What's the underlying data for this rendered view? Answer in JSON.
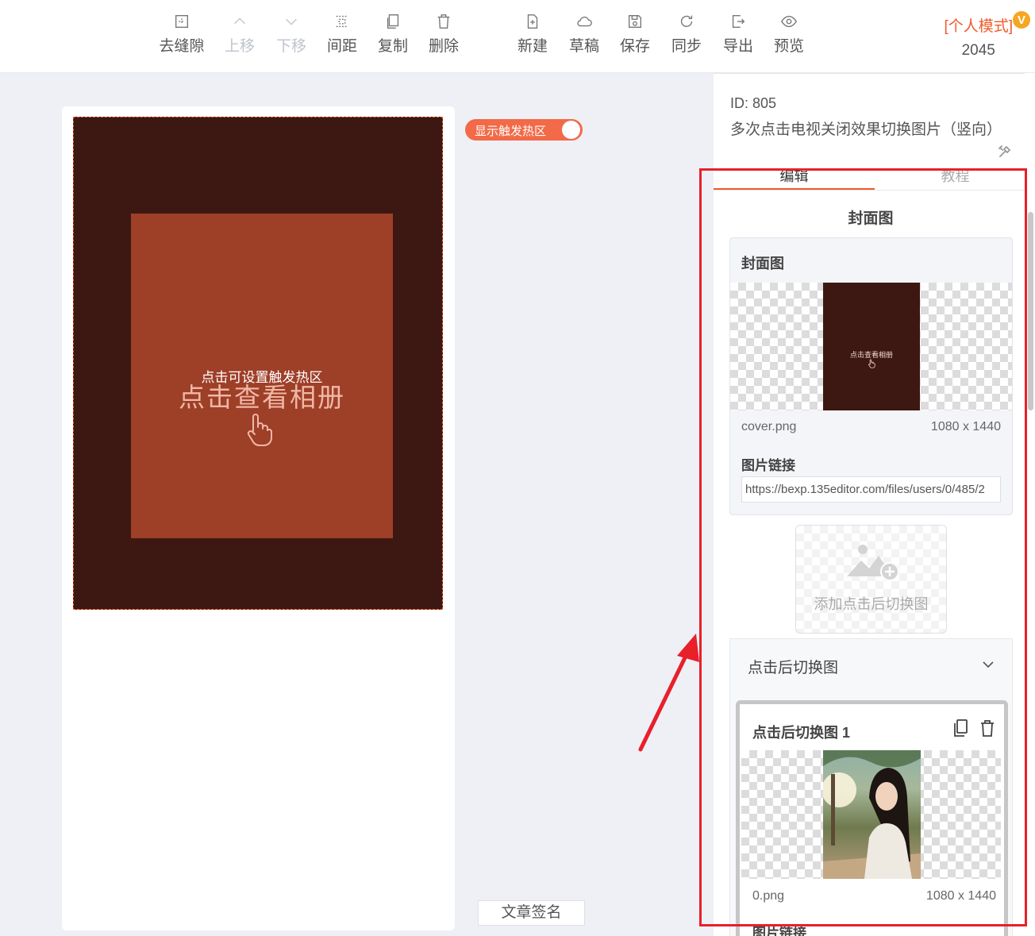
{
  "toolbar": {
    "items": [
      {
        "label": "去缝隙",
        "icon": "gap-remove-icon",
        "enabled": true
      },
      {
        "label": "上移",
        "icon": "chevron-up-icon",
        "enabled": false
      },
      {
        "label": "下移",
        "icon": "chevron-down-icon",
        "enabled": false
      },
      {
        "label": "间距",
        "icon": "spacing-icon",
        "enabled": true
      },
      {
        "label": "复制",
        "icon": "copy-icon",
        "enabled": true
      },
      {
        "label": "删除",
        "icon": "trash-icon",
        "enabled": true
      },
      {
        "label": "新建",
        "icon": "new-file-icon",
        "enabled": true
      },
      {
        "label": "草稿",
        "icon": "cloud-icon",
        "enabled": true
      },
      {
        "label": "保存",
        "icon": "save-icon",
        "enabled": true
      },
      {
        "label": "同步",
        "icon": "sync-icon",
        "enabled": true
      },
      {
        "label": "导出",
        "icon": "export-icon",
        "enabled": true
      },
      {
        "label": "预览",
        "icon": "eye-icon",
        "enabled": true
      }
    ],
    "mode_label": "[个人模式]",
    "mode_count": "2045",
    "vip_badge": "V"
  },
  "canvas": {
    "preview_title": "点击查看相册",
    "hotspot_hint": "点击可设置触发热区",
    "hotspot_toggle_label": "显示触发热区",
    "hotspot_toggle_on": true,
    "signature_button": "文章签名"
  },
  "panel": {
    "id_label": "ID: 805",
    "template_name": "多次点击电视关闭效果切换图片（竖向）",
    "tabs": [
      {
        "label": "编辑",
        "active": true
      },
      {
        "label": "教程",
        "active": false
      }
    ],
    "section_title": "封面图",
    "cover": {
      "heading": "封面图",
      "thumb_text": "点击查看相册",
      "file_name": "cover.png",
      "file_size": "1080 x 1440",
      "url_label": "图片链接",
      "url_value": "https://bexp.135editor.com/files/users/0/485/2"
    },
    "add_button_label": "添加点击后切换图",
    "switch_group": {
      "title": "点击后切换图",
      "item": {
        "title": "点击后切换图 1",
        "file_name": "0.png",
        "file_size": "1080 x 1440",
        "url_label": "图片链接"
      }
    }
  },
  "colors": {
    "accent": "#f05a2b",
    "preview_bg": "#3d1812",
    "preview_panel": "#9e3f28",
    "annotation_red": "#e8202a"
  }
}
